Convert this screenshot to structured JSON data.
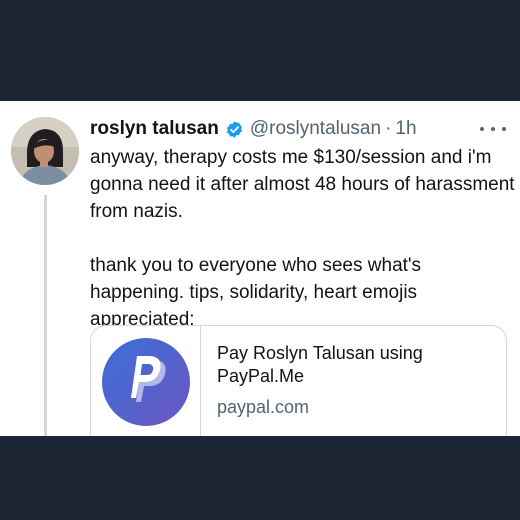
{
  "tweet": {
    "display_name": "roslyn talusan",
    "verified": true,
    "handle": "@roslyntalusan",
    "separator": "·",
    "time": "1h",
    "paragraphs": [
      "anyway, therapy costs me $130/session and i'm gonna need it after almost 48 hours of harassment from nazis.",
      "thank you to everyone who sees what's happening. tips, solidarity, heart emojis appreciated:"
    ]
  },
  "card": {
    "title": "Pay Roslyn Talusan using PayPal.Me",
    "domain": "paypal.com",
    "icon": "paypal-logo-icon"
  },
  "colors": {
    "background": "#1c2533",
    "verified_badge": "#1d9bf0",
    "secondary_text": "#536471",
    "paypal_gradient_start": "#3a6fd8",
    "paypal_gradient_end": "#6d56c1"
  },
  "icons": {
    "more": "more-horizontal-icon",
    "verified": "verified-badge-icon"
  }
}
